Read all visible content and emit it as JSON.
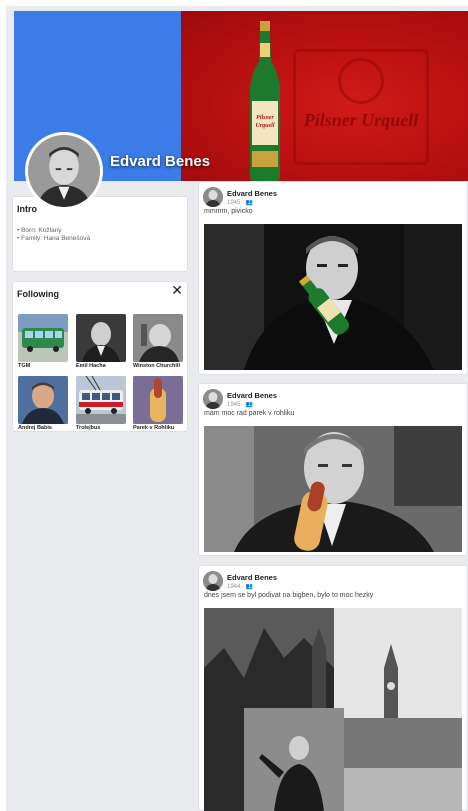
{
  "profile": {
    "name": "Edvard Benes",
    "cover_colors": {
      "left": "#3b7ce9",
      "right": "#c0141a"
    },
    "cover_bottle_label": "Pilsner Urquell",
    "cover_logo_text": "Pilsner Urquell"
  },
  "intro": {
    "title": "Intro",
    "details": [
      "Born: Kožlany",
      "Family: Hana Benešová"
    ]
  },
  "following": {
    "title": "Following",
    "close_icon": "close-icon",
    "items": [
      {
        "label": "TGM"
      },
      {
        "label": "Emil Hacha"
      },
      {
        "label": "Winston Churchill"
      },
      {
        "label": "Andrej Babis"
      },
      {
        "label": "Trolejbus"
      },
      {
        "label": "Parek v Rohliku"
      }
    ]
  },
  "posts": [
    {
      "author": "Edvard Benes",
      "year": "1945",
      "audience_icon": "friends-icon",
      "text": "mmmm, pivicko"
    },
    {
      "author": "Edvard Benes",
      "year": "1945",
      "audience_icon": "friends-icon",
      "text": "mam moc rad parek v rohliku"
    },
    {
      "author": "Edvard Benes",
      "year": "1944",
      "audience_icon": "friends-icon",
      "text": "dnes jsem se byl podivat na bigben, bylo to moc hezky"
    }
  ]
}
